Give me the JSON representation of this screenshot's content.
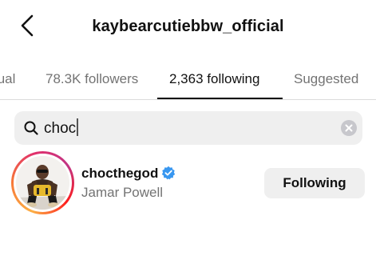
{
  "header": {
    "title": "kaybearcutiebbw_official",
    "back_icon": "chevron-left-icon"
  },
  "tabs": [
    {
      "label": "tual",
      "active": false
    },
    {
      "label": "78.3K followers",
      "active": false
    },
    {
      "label": "2,363 following",
      "active": true
    },
    {
      "label": "Suggested",
      "active": false
    }
  ],
  "search": {
    "value": "choc",
    "icon": "search-icon",
    "clear_icon": "clear-icon"
  },
  "results": [
    {
      "username": "chocthegod",
      "verified": true,
      "full_name": "Jamar Powell",
      "button_label": "Following",
      "has_story_ring": true
    }
  ],
  "colors": {
    "verified_blue": "#3897f0",
    "secondary_text": "#737373",
    "search_bg": "#efefef",
    "button_bg": "#efefef"
  }
}
